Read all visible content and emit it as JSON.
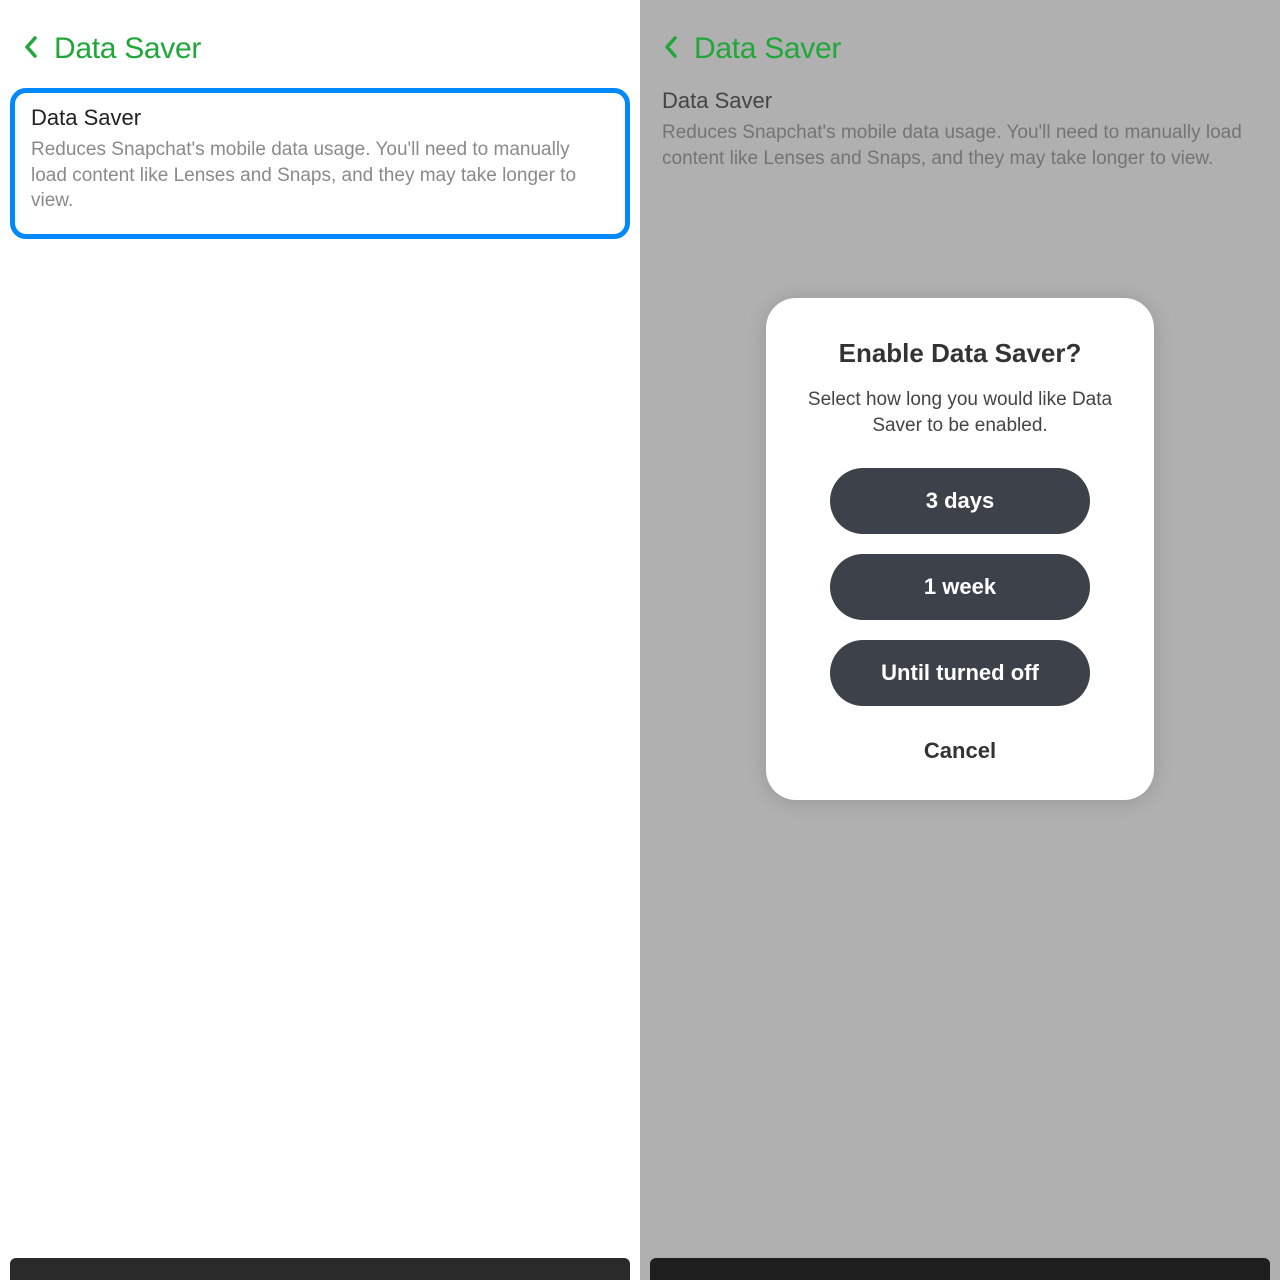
{
  "left": {
    "header_title": "Data Saver",
    "section_title": "Data Saver",
    "section_desc": "Reduces Snapchat's mobile data usage. You'll need to manually load content like Lenses and Snaps, and they may take longer to view."
  },
  "right": {
    "header_title": "Data Saver",
    "section_title": "Data Saver",
    "section_desc": "Reduces Snapchat's mobile data usage. You'll need to manually load content like Lenses and Snaps, and they may take longer to view.",
    "modal": {
      "title": "Enable Data Saver?",
      "subtitle": "Select how long you would like Data Saver to be enabled.",
      "options": [
        "3 days",
        "1 week",
        "Until turned off"
      ],
      "cancel": "Cancel"
    }
  },
  "colors": {
    "accent_green": "#1fa739",
    "highlight_blue": "#0088ff",
    "btn_dark": "#3d424a"
  }
}
